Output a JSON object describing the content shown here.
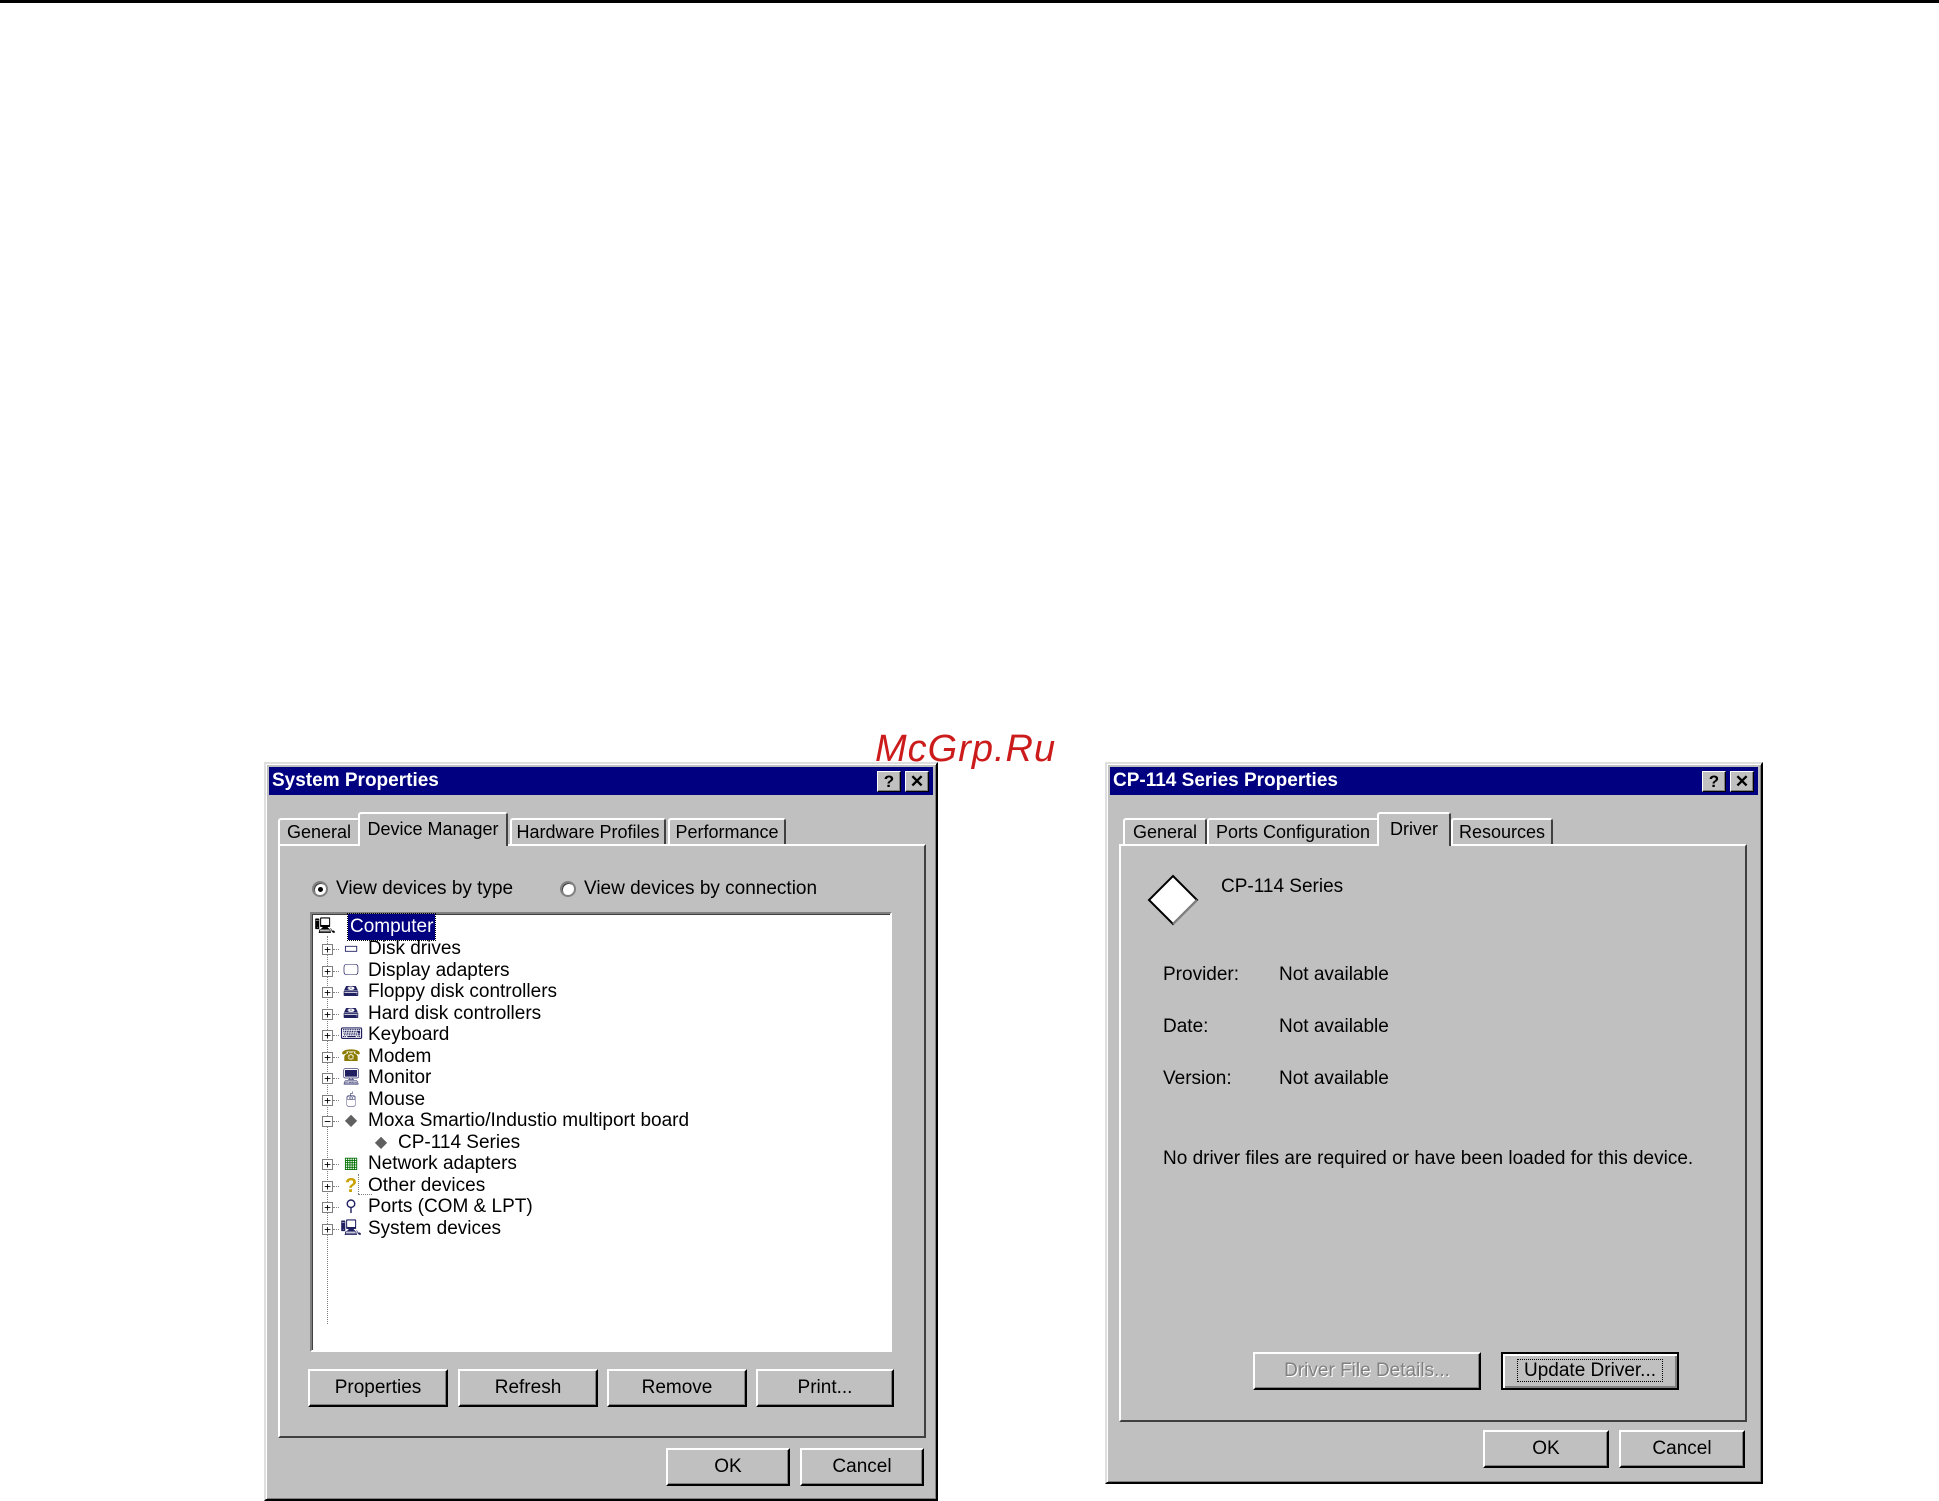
{
  "watermark": "McGrp.Ru",
  "system_properties": {
    "title": "System Properties",
    "tabs": [
      {
        "label": "General"
      },
      {
        "label": "Device Manager",
        "active": true
      },
      {
        "label": "Hardware Profiles"
      },
      {
        "label": "Performance"
      }
    ],
    "view_by_type": "View devices by type",
    "view_by_connection": "View devices by connection",
    "selected_view": "type",
    "tree": {
      "root": "Computer",
      "items": [
        {
          "label": "Disk drives",
          "icon": "disk-drive-icon"
        },
        {
          "label": "Display adapters",
          "icon": "display-adapter-icon"
        },
        {
          "label": "Floppy disk controllers",
          "icon": "floppy-controller-icon"
        },
        {
          "label": "Hard disk controllers",
          "icon": "hard-disk-controller-icon"
        },
        {
          "label": "Keyboard",
          "icon": "keyboard-icon"
        },
        {
          "label": "Modem",
          "icon": "modem-icon"
        },
        {
          "label": "Monitor",
          "icon": "monitor-icon"
        },
        {
          "label": "Mouse",
          "icon": "mouse-icon"
        },
        {
          "label": "Moxa Smartio/Industio multiport board",
          "icon": "multiport-board-icon",
          "expanded": true
        },
        {
          "label": "CP-114 Series",
          "icon": "multiport-board-icon",
          "child": true
        },
        {
          "label": "Network adapters",
          "icon": "network-adapter-icon"
        },
        {
          "label": "Other devices",
          "icon": "question-mark-icon"
        },
        {
          "label": "Ports (COM & LPT)",
          "icon": "port-icon"
        },
        {
          "label": "System devices",
          "icon": "system-devices-icon"
        }
      ]
    },
    "buttons": {
      "properties": "Properties",
      "refresh": "Refresh",
      "remove": "Remove",
      "print": "Print...",
      "ok": "OK",
      "cancel": "Cancel"
    }
  },
  "cp114_properties": {
    "title": "CP-114 Series Properties",
    "tabs": [
      {
        "label": "General"
      },
      {
        "label": "Ports Configuration"
      },
      {
        "label": "Driver",
        "active": true
      },
      {
        "label": "Resources"
      }
    ],
    "device_name": "CP-114 Series",
    "fields": [
      {
        "label": "Provider:",
        "value": "Not available"
      },
      {
        "label": "Date:",
        "value": "Not available"
      },
      {
        "label": "Version:",
        "value": "Not available"
      }
    ],
    "message": "No driver files are required or have been loaded for this device.",
    "buttons": {
      "driver_file_details": "Driver File Details...",
      "update_driver": "Update Driver...",
      "ok": "OK",
      "cancel": "Cancel"
    }
  }
}
